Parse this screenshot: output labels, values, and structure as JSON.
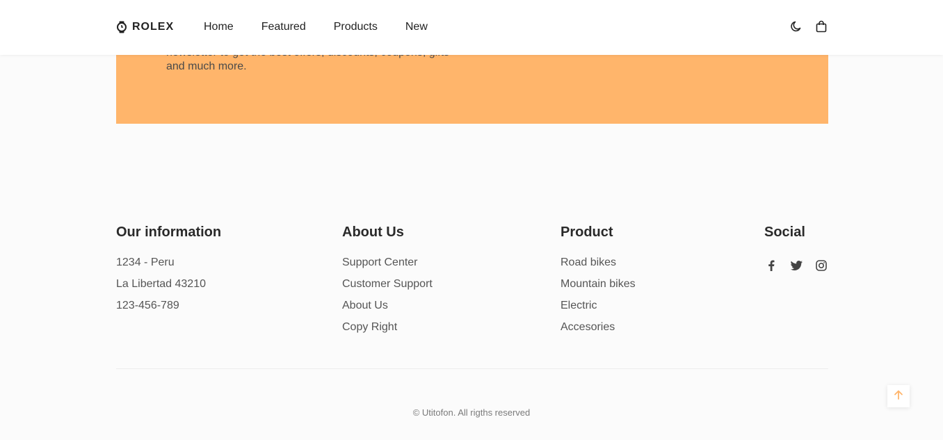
{
  "header": {
    "logo_text": "ROLEX",
    "nav": [
      "Home",
      "Featured",
      "Products",
      "New"
    ],
    "icons": [
      "watch-icon",
      "moon-icon",
      "shopping-bag-icon"
    ]
  },
  "banner": {
    "text_line1": "newsletter to get the best offers, discounts, coupons, gifts",
    "text_line2": "and much more.",
    "bg_color": "#ffb56b"
  },
  "footer": {
    "info": {
      "title": "Our information",
      "items": [
        "1234 - Peru",
        "La Libertad 43210",
        "123-456-789"
      ]
    },
    "about": {
      "title": "About Us",
      "items": [
        "Support Center",
        "Customer Support",
        "About Us",
        "Copy Right"
      ]
    },
    "product": {
      "title": "Product",
      "items": [
        "Road bikes",
        "Mountain bikes",
        "Electric",
        "Accesories"
      ]
    },
    "social": {
      "title": "Social",
      "icons": [
        "facebook-icon",
        "twitter-icon",
        "instagram-icon"
      ]
    },
    "copyright": "© Utitofon. All rigths reserved"
  },
  "accent_color": "#ffb56b"
}
